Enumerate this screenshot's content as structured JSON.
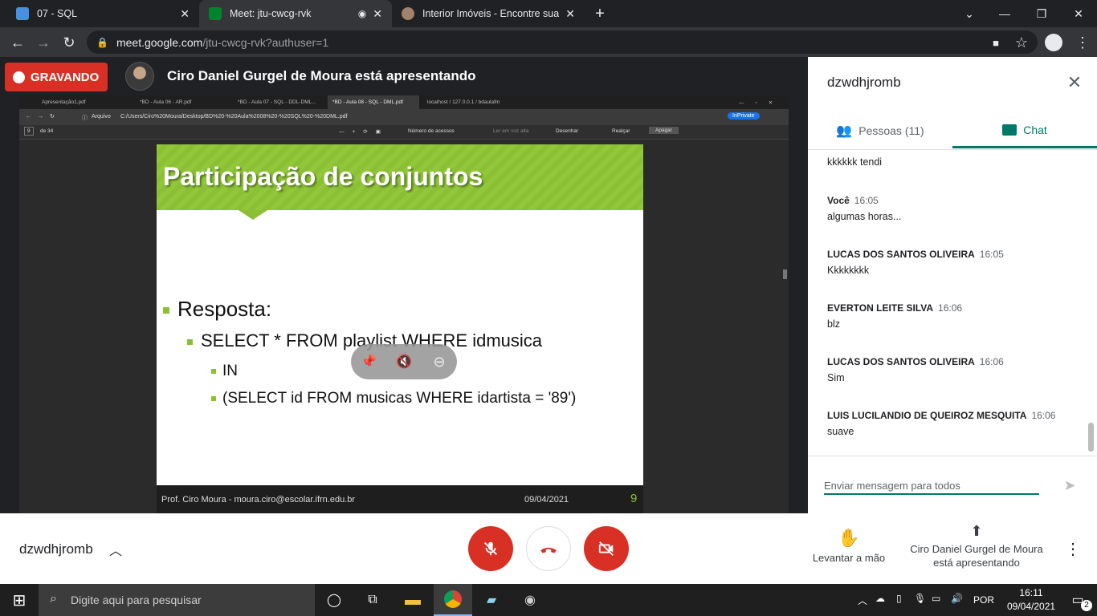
{
  "browser": {
    "tabs": [
      {
        "title": "07 - SQL",
        "active": false,
        "favicon_color": "#4a90e2"
      },
      {
        "title": "Meet: jtu-cwcg-rvk",
        "active": true,
        "favicon_color": "#00832d"
      },
      {
        "title": "Interior Imóveis - Encontre sua ca",
        "active": false,
        "favicon_color": "#a0826d"
      }
    ],
    "url_host": "meet.google.com",
    "url_path": "/jtu-cwcg-rvk?authuser=1"
  },
  "meet": {
    "recording_label": "GRAVANDO",
    "presenting_text": "Ciro Daniel Gurgel de Moura está apresentando"
  },
  "shared_screen": {
    "edge_tabs": [
      "Apresentação1.pdf",
      "*BD - Aula 06 - AR.pdf",
      "*BD - Aula 07 - SQL - DDL-DML...",
      "*BD - Aula 08 - SQL - DML.pdf",
      "localhost / 127.0.0.1 / bdaulafm"
    ],
    "address_label": "Arquivo",
    "address": "C:/Users/Ciro%20Moura/Desktop/BD%20-%20Aula%2008%20-%20SQL%20-%20DML.pdf",
    "inprivate": "InPrivate",
    "page_current": "9",
    "page_total": "de 34",
    "pdf_tools": [
      "Número de acessos",
      "Ler em voz alta",
      "Desenhar",
      "Realçar",
      "Apagar"
    ],
    "slide": {
      "title": "Participação de conjuntos",
      "bullets": [
        {
          "level": 1,
          "text": "Resposta:"
        },
        {
          "level": 2,
          "text": "SELECT * FROM playlist WHERE idmusica"
        },
        {
          "level": 3,
          "text": "IN"
        },
        {
          "level": 3,
          "text": "(SELECT id FROM musicas WHERE idartista = '89')"
        }
      ],
      "footer_author": "Prof. Ciro Moura - moura.ciro@escolar.ifrn.edu.br",
      "footer_date": "09/04/2021",
      "footer_page": "9"
    }
  },
  "panel": {
    "title": "dzwdhjromb",
    "tabs": {
      "people": "Pessoas (11)",
      "chat": "Chat"
    },
    "messages": [
      {
        "sender": "",
        "time": "",
        "text": "kkkkkk tendi"
      },
      {
        "sender": "Você",
        "time": "16:05",
        "text": "algumas horas..."
      },
      {
        "sender": "LUCAS DOS SANTOS OLIVEIRA",
        "time": "16:05",
        "text": "Kkkkkkkk"
      },
      {
        "sender": "EVERTON LEITE SILVA",
        "time": "16:06",
        "text": "blz"
      },
      {
        "sender": "LUCAS DOS SANTOS OLIVEIRA",
        "time": "16:06",
        "text": "Sim"
      },
      {
        "sender": "LUIS LUCILANDIO DE QUEIROZ MESQUITA",
        "time": "16:06",
        "text": "suave"
      }
    ],
    "input_placeholder": "Enviar mensagem para todos"
  },
  "controls": {
    "self_name": "dzwdhjromb",
    "raise_hand": "Levantar a mão",
    "presenting_line1": "Ciro Daniel Gurgel de Moura",
    "presenting_line2": "está apresentando"
  },
  "taskbar": {
    "search_placeholder": "Digite aqui para pesquisar",
    "language": "POR",
    "time": "16:11",
    "date": "09/04/2021",
    "notifications": "2"
  }
}
